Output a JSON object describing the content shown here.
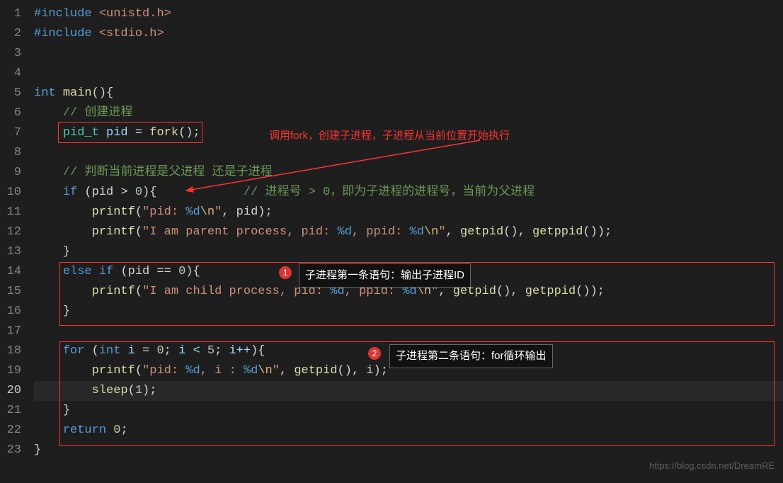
{
  "lines": {
    "1": "1",
    "2": "2",
    "3": "3",
    "4": "4",
    "5": "5",
    "6": "6",
    "7": "7",
    "8": "8",
    "9": "9",
    "10": "10",
    "11": "11",
    "12": "12",
    "13": "13",
    "14": "14",
    "15": "15",
    "16": "16",
    "17": "17",
    "18": "18",
    "19": "19",
    "20": "20",
    "21": "21",
    "22": "22",
    "23": "23"
  },
  "code": {
    "include1_kw": "#include",
    "include1_hdr": "<unistd.h>",
    "include2_kw": "#include",
    "include2_hdr": "<stdio.h>",
    "int_kw": "int",
    "main_fn": "main",
    "main_paren": "(){",
    "cmt_create": "// 创建进程",
    "pidt_type": "pid_t",
    "pid_var": "pid",
    "eq": "=",
    "fork_fn": "fork",
    "fork_call": "();",
    "cmt_judge": "// 判断当前进程是父进程 还是子进程",
    "if_kw": "if",
    "pid_gt0": "(pid > ",
    "zero1": "0",
    "brace1": "){",
    "cmt_parent": "// 进程号 > 0，即为子进程的进程号，当前为父进程",
    "printf_fn": "printf",
    "str_pid": "\"pid: ",
    "fmt_d": "%d",
    "esc_n": "\\n",
    "str_close": "\"",
    "comma_pid": ", pid);",
    "str_parent": "\"I am parent process, pid: ",
    "str_ppid": ", ppid: ",
    "getpid_fn": "getpid",
    "getppid_fn": "getppid",
    "call_paren": "()",
    "comma": ", ",
    "stmt_end": ");",
    "brace_close": "}",
    "else_kw": "else",
    "if_kw2": "if",
    "pid_eq0": "(pid == ",
    "zero2": "0",
    "brace2": "){",
    "str_child": "\"I am child process, pid: ",
    "for_kw": "for",
    "for_open": "(",
    "int_kw2": "int",
    "i_var": "i",
    "i_init": " = ",
    "zero3": "0",
    "semi": "; ",
    "i_lt": "i < ",
    "five": "5",
    "i_inc": "i++",
    "for_close": "){",
    "str_pidloop": "\"pid: ",
    "str_iloop": ", i : ",
    "comma_i": ", i);",
    "sleep_fn": "sleep",
    "sleep_arg": "(",
    "one": "1",
    "sleep_close": ");",
    "return_kw": "return",
    "return_val": "0",
    "return_end": ";"
  },
  "annotations": {
    "text1": "调用fork，创建子进程，子进程从当前位置开始执行",
    "badge1": "1",
    "callout1": "子进程第一条语句：输出子进程ID",
    "badge2": "2",
    "callout2": "子进程第二条语句：for循环输出"
  },
  "watermark": "https://blog.csdn.net/DreamRE"
}
